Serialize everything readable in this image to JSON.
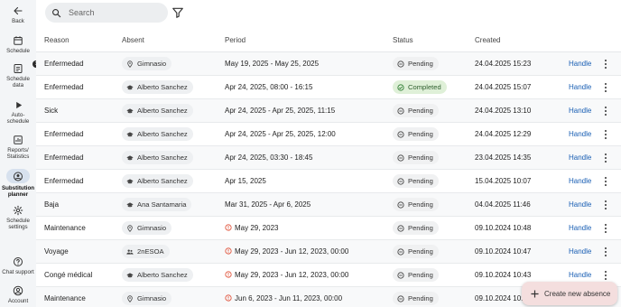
{
  "sidebar": {
    "items": [
      {
        "label": "Back",
        "icon": "back-arrow-icon"
      },
      {
        "label": "Schedule",
        "icon": "calendar-icon"
      },
      {
        "label": "Schedule\ndata",
        "icon": "document-icon",
        "badge": "1"
      },
      {
        "label": "Auto-\nschedule",
        "icon": "play-icon"
      },
      {
        "label": "Reports/\nStatistics",
        "icon": "chart-icon"
      },
      {
        "label": "Substitution\nplanner",
        "icon": "substitution-icon",
        "active": true
      },
      {
        "label": "Schedule\nsettings",
        "icon": "gear-icon"
      },
      {
        "label": "Chat support",
        "icon": "help-icon"
      },
      {
        "label": "Account",
        "icon": "account-icon"
      }
    ]
  },
  "search": {
    "placeholder": "Search"
  },
  "table": {
    "headers": {
      "reason": "Reason",
      "absent": "Absent",
      "period": "Period",
      "status": "Status",
      "created": "Created"
    },
    "handle_label": "Handle",
    "rows": [
      {
        "reason": "Enfermedad",
        "absent": "Gimnasio",
        "absent_type": "location",
        "period": "May 19, 2025 - May 25, 2025",
        "past": false,
        "status": "Pending",
        "created": "24.04.2025 15:23"
      },
      {
        "reason": "Enfermedad",
        "absent": "Alberto Sanchez",
        "absent_type": "teacher",
        "period": "Apr 24, 2025, 08:00 - 16:15",
        "past": false,
        "status": "Completed",
        "created": "24.04.2025 15:07"
      },
      {
        "reason": "Sick",
        "absent": "Alberto Sanchez",
        "absent_type": "teacher",
        "period": "Apr 24, 2025 - Apr 25, 2025, 11:15",
        "past": false,
        "status": "Pending",
        "created": "24.04.2025 13:10"
      },
      {
        "reason": "Enfermedad",
        "absent": "Alberto Sanchez",
        "absent_type": "teacher",
        "period": "Apr 24, 2025 - Apr 25, 2025, 12:00",
        "past": false,
        "status": "Pending",
        "created": "24.04.2025 12:29"
      },
      {
        "reason": "Enfermedad",
        "absent": "Alberto Sanchez",
        "absent_type": "teacher",
        "period": "Apr 24, 2025, 03:30 - 18:45",
        "past": false,
        "status": "Pending",
        "created": "23.04.2025 14:35"
      },
      {
        "reason": "Enfermedad",
        "absent": "Alberto Sanchez",
        "absent_type": "teacher",
        "period": "Apr 15, 2025",
        "past": false,
        "status": "Pending",
        "created": "15.04.2025 10:07"
      },
      {
        "reason": "Baja",
        "absent": "Ana Santamaria",
        "absent_type": "teacher",
        "period": "Mar 31, 2025 - Apr 6, 2025",
        "past": false,
        "status": "Pending",
        "created": "04.04.2025 11:46"
      },
      {
        "reason": "Maintenance",
        "absent": "Gimnasio",
        "absent_type": "location",
        "period": "May 29, 2023",
        "past": true,
        "status": "Pending",
        "created": "09.10.2024 10:48"
      },
      {
        "reason": "Voyage",
        "absent": "2nESOA",
        "absent_type": "group",
        "period": "May 29, 2023 - Jun 12, 2023, 00:00",
        "past": true,
        "status": "Pending",
        "created": "09.10.2024 10:47"
      },
      {
        "reason": "Congé médical",
        "absent": "Alberto Sanchez",
        "absent_type": "teacher",
        "period": "May 29, 2023 - Jun 12, 2023, 00:00",
        "past": true,
        "status": "Pending",
        "created": "09.10.2024 10:43"
      },
      {
        "reason": "Maintenance",
        "absent": "Gimnasio",
        "absent_type": "location",
        "period": "Jun 6, 2023 - Jun 11, 2023, 00:00",
        "past": true,
        "status": "Pending",
        "created": "09.10.2024 10:43"
      }
    ]
  },
  "fab": {
    "label": "Create new absence",
    "icon": "plus-icon"
  },
  "colors": {
    "link": "#1a5fb4",
    "warning": "#e0523a",
    "completed": "#dff0d8",
    "fab": "#f4dede"
  }
}
